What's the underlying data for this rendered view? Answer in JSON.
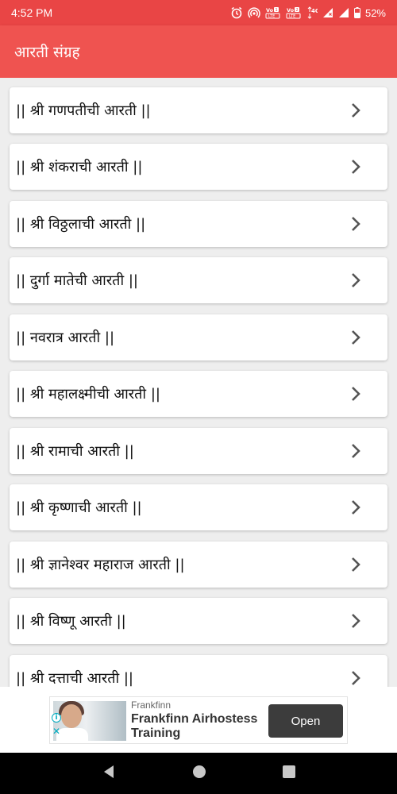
{
  "status_bar": {
    "time": "4:52 PM",
    "battery": "52%",
    "network": "4G",
    "sim1": "VoLTE1",
    "sim2": "VoLTE2",
    "icons": [
      "alarm-icon",
      "hotspot-icon",
      "volte1-icon",
      "volte2-icon",
      "4g-icon",
      "signal-icon",
      "signal-icon",
      "battery-icon"
    ]
  },
  "app_bar": {
    "title": "आरती संग्रह",
    "background": "#ef5350"
  },
  "list": {
    "items": [
      {
        "label": "|| श्री गणपतीची आरती ||"
      },
      {
        "label": "|| श्री शंकराची आरती ||"
      },
      {
        "label": "|| श्री विठ्ठलाची आरती ||"
      },
      {
        "label": "|| दुर्गा मातेची आरती ||"
      },
      {
        "label": "|| नवरात्र आरती ||"
      },
      {
        "label": "|| श्री महालक्ष्मीची आरती ||"
      },
      {
        "label": "|| श्री रामाची आरती ||"
      },
      {
        "label": "|| श्री कृष्णाची आरती ||"
      },
      {
        "label": "|| श्री ज्ञानेश्वर महाराज आरती ||"
      },
      {
        "label": "|| श्री विष्णू आरती ||"
      },
      {
        "label": "|| श्री दत्ताची आरती ||"
      }
    ],
    "item_icon": "chevron-right-icon"
  },
  "ad": {
    "brand": "Frankfinn",
    "headline": "Frankfinn Airhostess Training",
    "button": "Open"
  },
  "nav_bar": {
    "icons": [
      "back-icon",
      "home-icon",
      "recents-icon"
    ]
  }
}
